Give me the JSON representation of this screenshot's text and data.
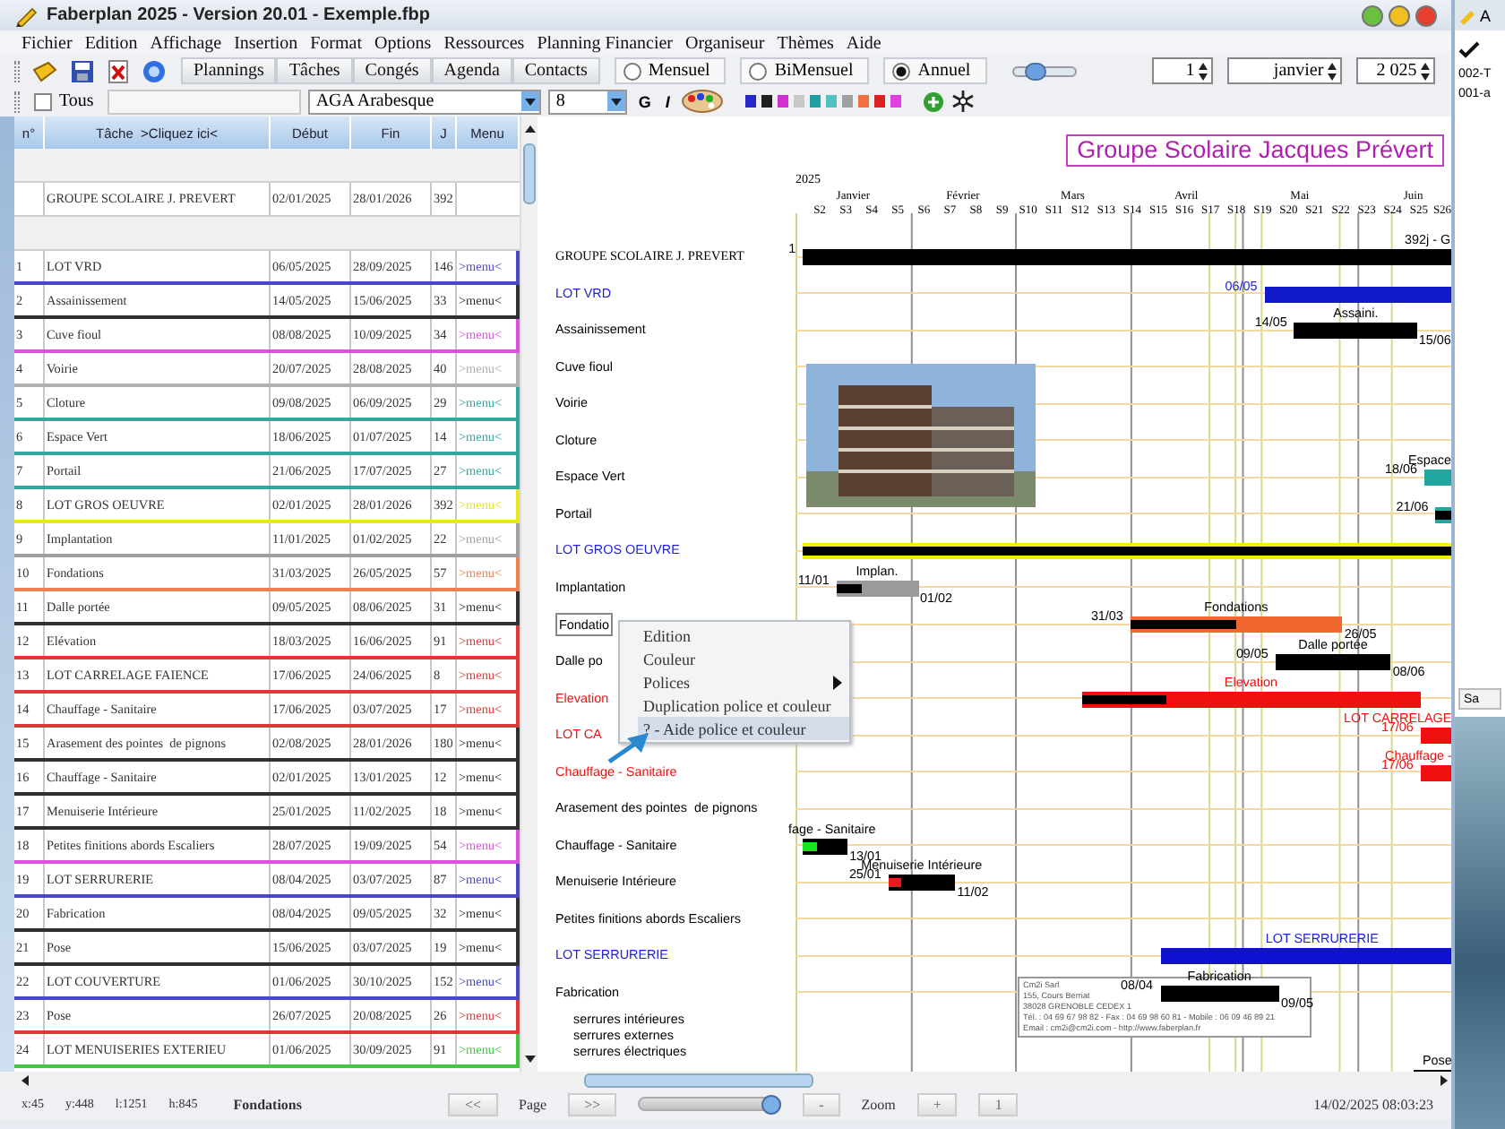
{
  "window": {
    "title": "Faberplan 2025 - Version 20.01 - Exemple.fbp"
  },
  "menu_bar": [
    "Fichier",
    "Edition",
    "Affichage",
    "Insertion",
    "Format",
    "Options",
    "Ressources",
    "Planning Financier",
    "Organiseur",
    "Thèmes",
    "Aide"
  ],
  "toolbar": {
    "view_buttons": [
      "Plannings",
      "Tâches",
      "Congés",
      "Agenda",
      "Contacts"
    ],
    "view_modes": [
      {
        "label": "Mensuel",
        "selected": false
      },
      {
        "label": "BiMensuel",
        "selected": false
      },
      {
        "label": "Annuel",
        "selected": true
      }
    ],
    "zoom_slider": {
      "level": 0.3
    },
    "spinners": [
      {
        "value": "1"
      },
      {
        "value": "janvier"
      },
      {
        "value": "2 025"
      }
    ]
  },
  "format_bar": {
    "all_checkbox": {
      "label": "Tous",
      "checked": false
    },
    "font": "AGA Arabesque",
    "size": "8",
    "style_buttons": [
      "G",
      "I"
    ],
    "swatches": [
      {
        "color": "#2828c8"
      },
      {
        "color": "#202020"
      },
      {
        "color": "#d030d0"
      },
      {
        "color": "#c8c8c8"
      },
      {
        "color": "#20a0a0"
      },
      {
        "color": "#50c0c0"
      },
      {
        "color": "#a0a0a0"
      },
      {
        "color": "#f07040"
      },
      {
        "color": "#e02020"
      },
      {
        "color": "#e040e0"
      }
    ]
  },
  "table": {
    "columns": [
      "n°",
      "Tâche  >Cliquez ici<",
      "Début",
      "Fin",
      "J",
      "Menu"
    ],
    "rows": [
      {
        "kind": "blank"
      },
      {
        "kind": "group",
        "task": "GROUPE SCOLAIRE J. PREVERT",
        "start": "02/01/2025",
        "end": "28/01/2026",
        "days": "392"
      },
      {
        "kind": "blank"
      },
      {
        "kind": "task",
        "n": "1",
        "task": "LOT VRD",
        "start": "06/05/2025",
        "end": "28/09/2025",
        "days": "146",
        "menu": ">menu<",
        "color": "#4848c8"
      },
      {
        "kind": "task",
        "n": "2",
        "task": "Assainissement",
        "start": "14/05/2025",
        "end": "15/06/2025",
        "days": "33",
        "menu": ">menu<",
        "color": "#303030"
      },
      {
        "kind": "task",
        "n": "3",
        "task": "Cuve fioul",
        "start": "08/08/2025",
        "end": "10/09/2025",
        "days": "34",
        "menu": ">menu<",
        "color": "#e050e0"
      },
      {
        "kind": "task",
        "n": "4",
        "task": "Voirie",
        "start": "20/07/2025",
        "end": "28/08/2025",
        "days": "40",
        "menu": ">menu<",
        "color": "#b0b0b0"
      },
      {
        "kind": "task",
        "n": "5",
        "task": "Cloture",
        "start": "09/08/2025",
        "end": "06/09/2025",
        "days": "29",
        "menu": ">menu<",
        "color": "#30a8a0"
      },
      {
        "kind": "task",
        "n": "6",
        "task": "Espace Vert",
        "start": "18/06/2025",
        "end": "01/07/2025",
        "days": "14",
        "menu": ">menu<",
        "color": "#30a8a0"
      },
      {
        "kind": "task",
        "n": "7",
        "task": "Portail",
        "start": "21/06/2025",
        "end": "17/07/2025",
        "days": "27",
        "menu": ">menu<",
        "color": "#30a8a0"
      },
      {
        "kind": "task",
        "n": "8",
        "task": "LOT GROS OEUVRE",
        "start": "02/01/2025",
        "end": "28/01/2026",
        "days": "392",
        "menu": ">menu<",
        "color": "#e8e820"
      },
      {
        "kind": "task",
        "n": "9",
        "task": "Implantation",
        "start": "11/01/2025",
        "end": "01/02/2025",
        "days": "22",
        "menu": ">menu<",
        "color": "#a0a0a0"
      },
      {
        "kind": "task",
        "n": "10",
        "task": "Fondations",
        "start": "31/03/2025",
        "end": "26/05/2025",
        "days": "57",
        "menu": ">menu<",
        "color": "#f08050"
      },
      {
        "kind": "task",
        "n": "11",
        "task": "Dalle portée",
        "start": "09/05/2025",
        "end": "08/06/2025",
        "days": "31",
        "menu": ">menu<",
        "color": "#303030"
      },
      {
        "kind": "task",
        "n": "12",
        "task": "Elévation",
        "start": "18/03/2025",
        "end": "16/06/2025",
        "days": "91",
        "menu": ">menu<",
        "color": "#e03838"
      },
      {
        "kind": "task",
        "n": "13",
        "task": "LOT CARRELAGE FAIENCE",
        "start": "17/06/2025",
        "end": "24/06/2025",
        "days": "8",
        "menu": ">menu<",
        "color": "#e03838"
      },
      {
        "kind": "task",
        "n": "14",
        "task": "Chauffage - Sanitaire",
        "start": "17/06/2025",
        "end": "03/07/2025",
        "days": "17",
        "menu": ">menu<",
        "color": "#e03838"
      },
      {
        "kind": "task",
        "n": "15",
        "task": "Arasement des pointes  de pignons",
        "start": "02/08/2025",
        "end": "28/01/2026",
        "days": "180",
        "menu": ">menu<",
        "color": "#303030"
      },
      {
        "kind": "task",
        "n": "16",
        "task": "Chauffage - Sanitaire",
        "start": "02/01/2025",
        "end": "13/01/2025",
        "days": "12",
        "menu": ">menu<",
        "color": "#303030"
      },
      {
        "kind": "task",
        "n": "17",
        "task": "Menuiserie Intérieure",
        "start": "25/01/2025",
        "end": "11/02/2025",
        "days": "18",
        "menu": ">menu<",
        "color": "#303030"
      },
      {
        "kind": "task",
        "n": "18",
        "task": "Petites finitions abords Escaliers",
        "start": "28/07/2025",
        "end": "19/09/2025",
        "days": "54",
        "menu": ">menu<",
        "color": "#e050e0"
      },
      {
        "kind": "task",
        "n": "19",
        "task": "LOT SERRURERIE",
        "start": "08/04/2025",
        "end": "03/07/2025",
        "days": "87",
        "menu": ">menu<",
        "color": "#4848c8"
      },
      {
        "kind": "task",
        "n": "20",
        "task": "Fabrication",
        "start": "08/04/2025",
        "end": "09/05/2025",
        "days": "32",
        "menu": ">menu<",
        "color": "#303030"
      },
      {
        "kind": "task",
        "n": "21",
        "task": "Pose",
        "start": "15/06/2025",
        "end": "03/07/2025",
        "days": "19",
        "menu": ">menu<",
        "color": "#303030"
      },
      {
        "kind": "task",
        "n": "22",
        "task": "LOT COUVERTURE",
        "start": "01/06/2025",
        "end": "30/10/2025",
        "days": "152",
        "menu": ">menu<",
        "color": "#4848c8"
      },
      {
        "kind": "task",
        "n": "23",
        "task": "Pose",
        "start": "26/07/2025",
        "end": "20/08/2025",
        "days": "26",
        "menu": ">menu<",
        "color": "#e03838"
      },
      {
        "kind": "task",
        "n": "24",
        "task": "LOT MENUISERIES EXTERIEU",
        "start": "01/06/2025",
        "end": "30/09/2025",
        "days": "91",
        "menu": ">menu<",
        "color": "#40c840"
      }
    ]
  },
  "gantt": {
    "title": "Groupe Scolaire Jacques Prévert",
    "year": "2025",
    "months": [
      "Janvier",
      "Février",
      "Mars",
      "Avril",
      "Mai",
      "Juin"
    ],
    "weeks": [
      "S2",
      "S3",
      "S4",
      "S5",
      "S6",
      "S7",
      "S8",
      "S9",
      "S10",
      "S11",
      "S12",
      "S13",
      "S14",
      "S15",
      "S16",
      "S17",
      "S18",
      "S19",
      "S20",
      "S21",
      "S22",
      "S23",
      "S24",
      "S25",
      "S26"
    ],
    "rows": [
      {
        "kind": "group",
        "label": "GROUPE SCOLAIRE J. PREVERT",
        "color": "#000000",
        "bar": {
          "color": "#000000",
          "title": "392j - G",
          "start_label": "1"
        }
      },
      {
        "kind": "task",
        "label": "LOT VRD",
        "color": "#2020e0",
        "bar": {
          "color": "#1018c8",
          "start_label": "06/05"
        }
      },
      {
        "kind": "task",
        "label": "Assainissement",
        "color": "#000000",
        "bar": {
          "color": "#000000",
          "title": "Assaini.",
          "start_label": "14/05",
          "end_label": "15/06"
        }
      },
      {
        "kind": "task",
        "label": "Cuve fioul",
        "color": "#000000"
      },
      {
        "kind": "task",
        "label": "Voirie",
        "color": "#000000"
      },
      {
        "kind": "task",
        "label": "Cloture",
        "color": "#000000"
      },
      {
        "kind": "task",
        "label": "Espace Vert",
        "color": "#000000",
        "bar": {
          "color": "#20a8a0",
          "title": "Espace",
          "start_label": "18/06"
        }
      },
      {
        "kind": "task",
        "label": "Portail",
        "color": "#000000",
        "bar": {
          "color": "#20a8a0",
          "progress": {
            "color": "#000000",
            "level": 0.8
          },
          "start_label": "21/06"
        }
      },
      {
        "kind": "task",
        "label": "LOT GROS OEUVRE",
        "color": "#2020e0",
        "bar": {
          "color": "#f0f000",
          "progress": {
            "color": "#000000",
            "level": 1
          }
        }
      },
      {
        "kind": "task",
        "label": "Implantation",
        "color": "#000000",
        "bar": {
          "color": "#9a9a9a",
          "progress": {
            "color": "#000000",
            "level": 0.3
          },
          "title": "Implan.",
          "start_label": "11/01",
          "end_label": "01/02"
        }
      },
      {
        "kind": "boxed",
        "label": "Fondatio",
        "color": "#000000",
        "bar": {
          "color": "#f06830",
          "progress": {
            "color": "#000000",
            "level": 0.5
          },
          "title": "Fondations",
          "start_label": "31/03",
          "end_label": "26/05"
        }
      },
      {
        "kind": "task",
        "label": "Dalle po",
        "color": "#000000",
        "bar": {
          "color": "#000000",
          "title": "Dalle portée",
          "start_label": "09/05",
          "end_label": "08/06"
        }
      },
      {
        "kind": "task",
        "label": "Elevation",
        "color": "#f01010",
        "bar": {
          "color": "#f01010",
          "progress": {
            "color": "#000000",
            "level": 0.25
          },
          "title": "Elevation"
        }
      },
      {
        "kind": "task",
        "label": "LOT CA",
        "color": "#f01010",
        "bar": {
          "color": "#f01010",
          "title": "LOT CARRELAGE",
          "start_label": "17/06"
        }
      },
      {
        "kind": "task",
        "label": "Chauffage - Sanitaire",
        "color": "#f01010",
        "bar": {
          "color": "#f01010",
          "title": "Chauffage -",
          "start_label": "17/06"
        }
      },
      {
        "kind": "task",
        "label": "Arasement des pointes  de pignons",
        "color": "#000000"
      },
      {
        "kind": "task",
        "label": "Chauffage - Sanitaire",
        "color": "#000000",
        "bar": {
          "color": "#000000",
          "progress": {
            "color": "#20e020",
            "level": 0.3
          },
          "title": "fage - Sanitaire",
          "end_label": "13/01"
        }
      },
      {
        "kind": "task",
        "label": "Menuiserie Intérieure",
        "color": "#000000",
        "bar": {
          "color": "#000000",
          "progress": {
            "color": "#e02020",
            "level": 0.2
          },
          "title": "Menuiserie Intérieure",
          "start_label": "25/01",
          "end_label": "11/02"
        }
      },
      {
        "kind": "task",
        "label": "Petites finitions abords Escaliers",
        "color": "#000000"
      },
      {
        "kind": "task",
        "label": "LOT SERRURERIE",
        "color": "#2020e0",
        "bar": {
          "color": "#1010d0",
          "title": "LOT SERRURERIE"
        }
      },
      {
        "kind": "task",
        "label": "Fabrication",
        "color": "#000000",
        "sublines": [
          "serrures intérieures",
          "serrures externes",
          "serrures électriques"
        ],
        "bar": {
          "color": "#000000",
          "title": "Fabrication",
          "start_label": "08/04",
          "end_label": "09/05"
        }
      },
      {
        "kind": "task",
        "bar": {
          "color": "#000000",
          "title": "Pose"
        }
      }
    ],
    "address": [
      "Cm2i Sarl",
      "155, Cours Berriat",
      "38028 GRENOBLE CEDEX 1",
      "Tél. : 04 69 67 98 82 - Fax : 04 69 98 60 81 - Mobile : 06 09 46 89 21",
      "Email : cm2i@cm2i.com - http://www.faberplan.fr"
    ]
  },
  "context_menu": [
    {
      "label": "Edition",
      "selected": false,
      "submenu": false
    },
    {
      "label": "Couleur",
      "selected": false,
      "submenu": false
    },
    {
      "label": "Polices",
      "selected": false,
      "submenu": true
    },
    {
      "label": "Duplication police et couleur",
      "selected": false,
      "submenu": false
    },
    {
      "label": "? - Aide police et couleur",
      "selected": true,
      "submenu": false
    }
  ],
  "status_bar": {
    "coords": [
      "x:45",
      "y:448",
      "l:1251",
      "h:845"
    ],
    "task": "Fondations",
    "page_prev": "<<",
    "page_label": "Page",
    "page_next": ">>",
    "zoom_slider": {
      "level": 1
    },
    "zoom_minus": "-",
    "zoom_label": "Zoom",
    "zoom_plus": "+",
    "zoom_reset": "1",
    "datetime": "14/02/2025 08:03:23"
  },
  "side_window": {
    "title": "A",
    "items": [
      "002-T",
      "001-a"
    ],
    "button": "Sa"
  }
}
